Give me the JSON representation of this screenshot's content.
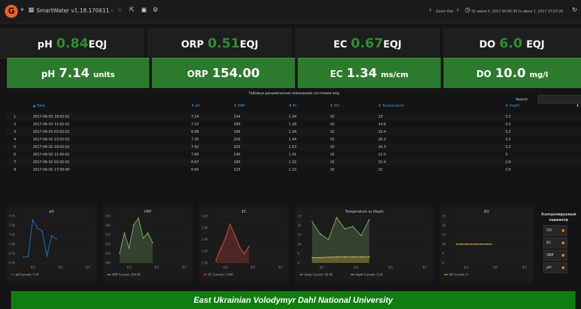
{
  "topbar": {
    "logo_glyph": "G",
    "dashboard_title": "SmartWater v1.18.170611 -",
    "zoom_out": "Zoom Out",
    "time_range": "01 июня 3, 2017 04:00:35 to июня 7, 2017 17:07:20",
    "accent": "#eb7b18"
  },
  "stats_top": [
    {
      "label": "pH",
      "value": "0.84",
      "unit": "EQJ"
    },
    {
      "label": "ORP",
      "value": "0.51",
      "unit": "EQJ"
    },
    {
      "label": "EC",
      "value": "0.67",
      "unit": "EQJ"
    },
    {
      "label": "DO",
      "value": "6.0",
      "unit": "EQJ"
    }
  ],
  "stats_bottom": [
    {
      "label": "pH",
      "value": "7.14",
      "unit": "units"
    },
    {
      "label": "ORP",
      "value": "154.00",
      "unit": ""
    },
    {
      "label": "EC",
      "value": "1.34",
      "unit": "ms/cm"
    },
    {
      "label": "DO",
      "value": "10.0",
      "unit": "mg/l"
    }
  ],
  "table": {
    "title": "Таблица динамических изменений состояния вод",
    "search_label": "Search:",
    "headers": [
      "Date",
      "pH",
      "ORP",
      "EC",
      "DO",
      "Temperature",
      "Depth"
    ],
    "rows": [
      [
        "1",
        "2017-06-03 19:02:02",
        "7.14",
        "154",
        "1.34",
        "10",
        "23",
        "3.2"
      ],
      [
        "2",
        "2017-06-03 11:02:02",
        "7.22",
        "180",
        "1.28",
        "10",
        "14.6",
        "3.2"
      ],
      [
        "3",
        "2017-06-03 03:02:02",
        "6.68",
        "166",
        "1.34",
        "10",
        "19.4",
        "3.2"
      ],
      [
        "4",
        "2017-06-02 23:02:02",
        "7.35",
        "220",
        "1.44",
        "10",
        "18.2",
        "3.2"
      ],
      [
        "5",
        "2017-06-02 19:02:02",
        "7.42",
        "202",
        "1.53",
        "10",
        "24.3",
        "3.2"
      ],
      [
        "6",
        "2017-06-02 11:00:02",
        "7.65",
        "140",
        "1.41",
        "10",
        "12.5",
        "3"
      ],
      [
        "7",
        "2017-06-02 03:02:02",
        "6.67",
        "180",
        "1.32",
        "10",
        "15.4",
        "2.8"
      ],
      [
        "8",
        "2017-06-01 17:00:00",
        "6.65",
        "125",
        "1.22",
        "10",
        "22",
        "2.8"
      ]
    ]
  },
  "charts": [
    {
      "title": "pH",
      "yticks": [
        "7.75",
        "7.50",
        "7.25",
        "7.00",
        "6.75",
        "6.50"
      ],
      "xticks": [
        "6/3",
        "6/5",
        "6/7"
      ],
      "legend": "pH  Current: 7.14"
    },
    {
      "title": "ORP",
      "yticks": [
        "225",
        "200",
        "175",
        "150",
        "125",
        "100"
      ],
      "xticks": [
        "6/3",
        "6/5",
        "6/7"
      ],
      "legend": "ORP  Current: 154.00"
    },
    {
      "title": "EC",
      "yticks": [
        "1.60",
        "1.50",
        "1.40",
        "1.30",
        "1.20"
      ],
      "xticks": [
        "6/3",
        "6/5",
        "6/7"
      ],
      "legend": "EC  Current: 1.340"
    },
    {
      "title": "Temperature vs Depth",
      "yticks": [
        "25",
        "20",
        "15",
        "10",
        "5",
        "0"
      ],
      "xticks": [
        "6/1",
        "6/3",
        "6/5",
        "6/7"
      ],
      "legend": "temp  Current: 10.40",
      "legend2": "depth  Current: 3.20"
    },
    {
      "title": "DO",
      "yticks": [
        "25",
        "20",
        "15",
        "10",
        "5",
        "0"
      ],
      "xticks": [
        "6/3",
        "6/5",
        "6/7"
      ],
      "legend": "DO  Current: 0"
    }
  ],
  "chart_data": [
    {
      "type": "line",
      "title": "pH",
      "x": [
        "6/1 17:00",
        "6/2 03:02",
        "6/2 11:00",
        "6/2 19:02",
        "6/2 23:02",
        "6/3 03:02",
        "6/3 11:02",
        "6/3 19:02"
      ],
      "values": [
        6.65,
        6.67,
        7.65,
        7.42,
        7.35,
        6.68,
        7.22,
        7.14
      ],
      "ylim": [
        6.5,
        7.75
      ],
      "color": "#1f78c1"
    },
    {
      "type": "area",
      "title": "ORP",
      "x": [
        "6/1 17:00",
        "6/2 03:02",
        "6/2 11:00",
        "6/2 19:02",
        "6/2 23:02",
        "6/3 03:02",
        "6/3 11:02",
        "6/3 19:02"
      ],
      "values": [
        125,
        180,
        140,
        202,
        220,
        166,
        180,
        154
      ],
      "ylim": [
        100,
        225
      ],
      "color": "#7eb26d"
    },
    {
      "type": "area",
      "title": "EC",
      "x": [
        "6/1 17:00",
        "6/2 03:02",
        "6/2 11:00",
        "6/2 19:02",
        "6/2 23:02",
        "6/3 03:02",
        "6/3 11:02",
        "6/3 19:02"
      ],
      "values": [
        1.22,
        1.32,
        1.41,
        1.53,
        1.44,
        1.34,
        1.28,
        1.34
      ],
      "ylim": [
        1.2,
        1.6
      ],
      "color": "#e24d42"
    },
    {
      "type": "area",
      "title": "Temperature vs Depth",
      "x": [
        "6/1 17:00",
        "6/2 03:02",
        "6/2 11:00",
        "6/2 19:02",
        "6/2 23:02",
        "6/3 03:02",
        "6/3 11:02",
        "6/3 19:02"
      ],
      "series": [
        {
          "name": "temp",
          "values": [
            22,
            15.4,
            12.5,
            24.3,
            18.2,
            19.4,
            14.6,
            23
          ],
          "color": "#7eb26d"
        },
        {
          "name": "depth",
          "values": [
            2.8,
            2.8,
            3,
            3.2,
            3.2,
            3.2,
            3.2,
            3.2
          ],
          "color": "#eab839"
        }
      ],
      "ylim": [
        0,
        25
      ]
    },
    {
      "type": "line",
      "title": "DO",
      "x": [
        "6/1 17:00",
        "6/2 03:02",
        "6/2 11:00",
        "6/2 19:02",
        "6/2 23:02",
        "6/3 03:02",
        "6/3 11:02",
        "6/3 19:02"
      ],
      "values": [
        10,
        10,
        10,
        10,
        10,
        10,
        10,
        10
      ],
      "ylim": [
        0,
        25
      ],
      "color": "#eab839"
    }
  ],
  "param_panel": {
    "title": "Контролируемый параметр",
    "buttons": [
      "DO",
      "EC",
      "ORP",
      "pH"
    ]
  },
  "footer": {
    "text": "East Ukrainian Volodymyr Dahl National University"
  }
}
